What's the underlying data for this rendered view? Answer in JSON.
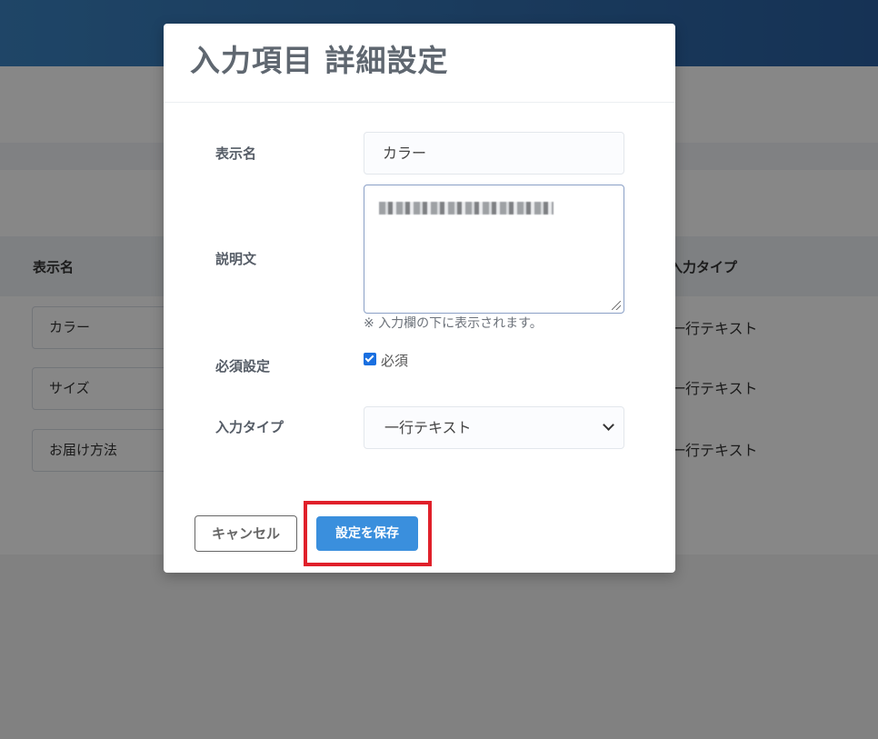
{
  "background": {
    "table": {
      "headers": [
        "表示名",
        "入力タイプ"
      ],
      "rows": [
        {
          "name": "カラー",
          "type": "一行テキスト"
        },
        {
          "name": "サイズ",
          "type": "一行テキスト"
        },
        {
          "name": "お届け方法",
          "type": "一行テキスト"
        }
      ]
    }
  },
  "modal": {
    "title": "入力項目 詳細設定",
    "display_name": {
      "label": "表示名",
      "value": "カラー"
    },
    "description": {
      "label": "説明文",
      "hint": "※ 入力欄の下に表示されます。"
    },
    "required": {
      "label": "必須設定",
      "checkbox_label": "必須",
      "checked": true
    },
    "input_type": {
      "label": "入力タイプ",
      "selected": "一行テキスト"
    },
    "cancel_label": "キャンセル",
    "save_label": "設定を保存"
  },
  "colors": {
    "header": "#2a5fa0",
    "save_button": "#3a8fdd",
    "highlight": "#e0202a",
    "checkbox": "#1a6fe0"
  }
}
